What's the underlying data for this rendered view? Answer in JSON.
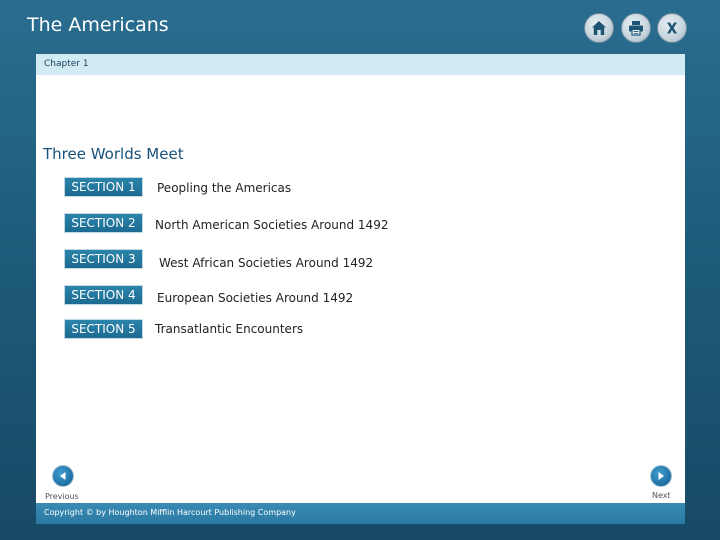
{
  "app": {
    "title": "The Americans"
  },
  "toolbar": {
    "home_icon": "home-icon",
    "print_icon": "print-icon",
    "close_icon": "close-icon"
  },
  "chapter": {
    "label": "Chapter 1"
  },
  "main": {
    "heading": "Three Worlds Meet",
    "sections": [
      {
        "button": "SECTION 1",
        "title": "Peopling the Americas"
      },
      {
        "button": "SECTION 2",
        "title": "North American Societies Around 1492"
      },
      {
        "button": "SECTION 3",
        "title": "West African Societies Around 1492"
      },
      {
        "button": "SECTION 4",
        "title": "European Societies Around 1492"
      },
      {
        "button": "SECTION 5",
        "title": "Transatlantic Encounters"
      }
    ]
  },
  "nav": {
    "previous_label": "Previous",
    "next_label": "Next"
  },
  "footer": {
    "copyright": "Copyright © by Houghton Mifflin Harcourt Publishing Company"
  },
  "colors": {
    "frame": "#1f5f7f",
    "chapter_bar": "#d0ebf4",
    "section_button": "#2280a8",
    "heading": "#17527a",
    "footer_bar": "#3a8bb4"
  }
}
